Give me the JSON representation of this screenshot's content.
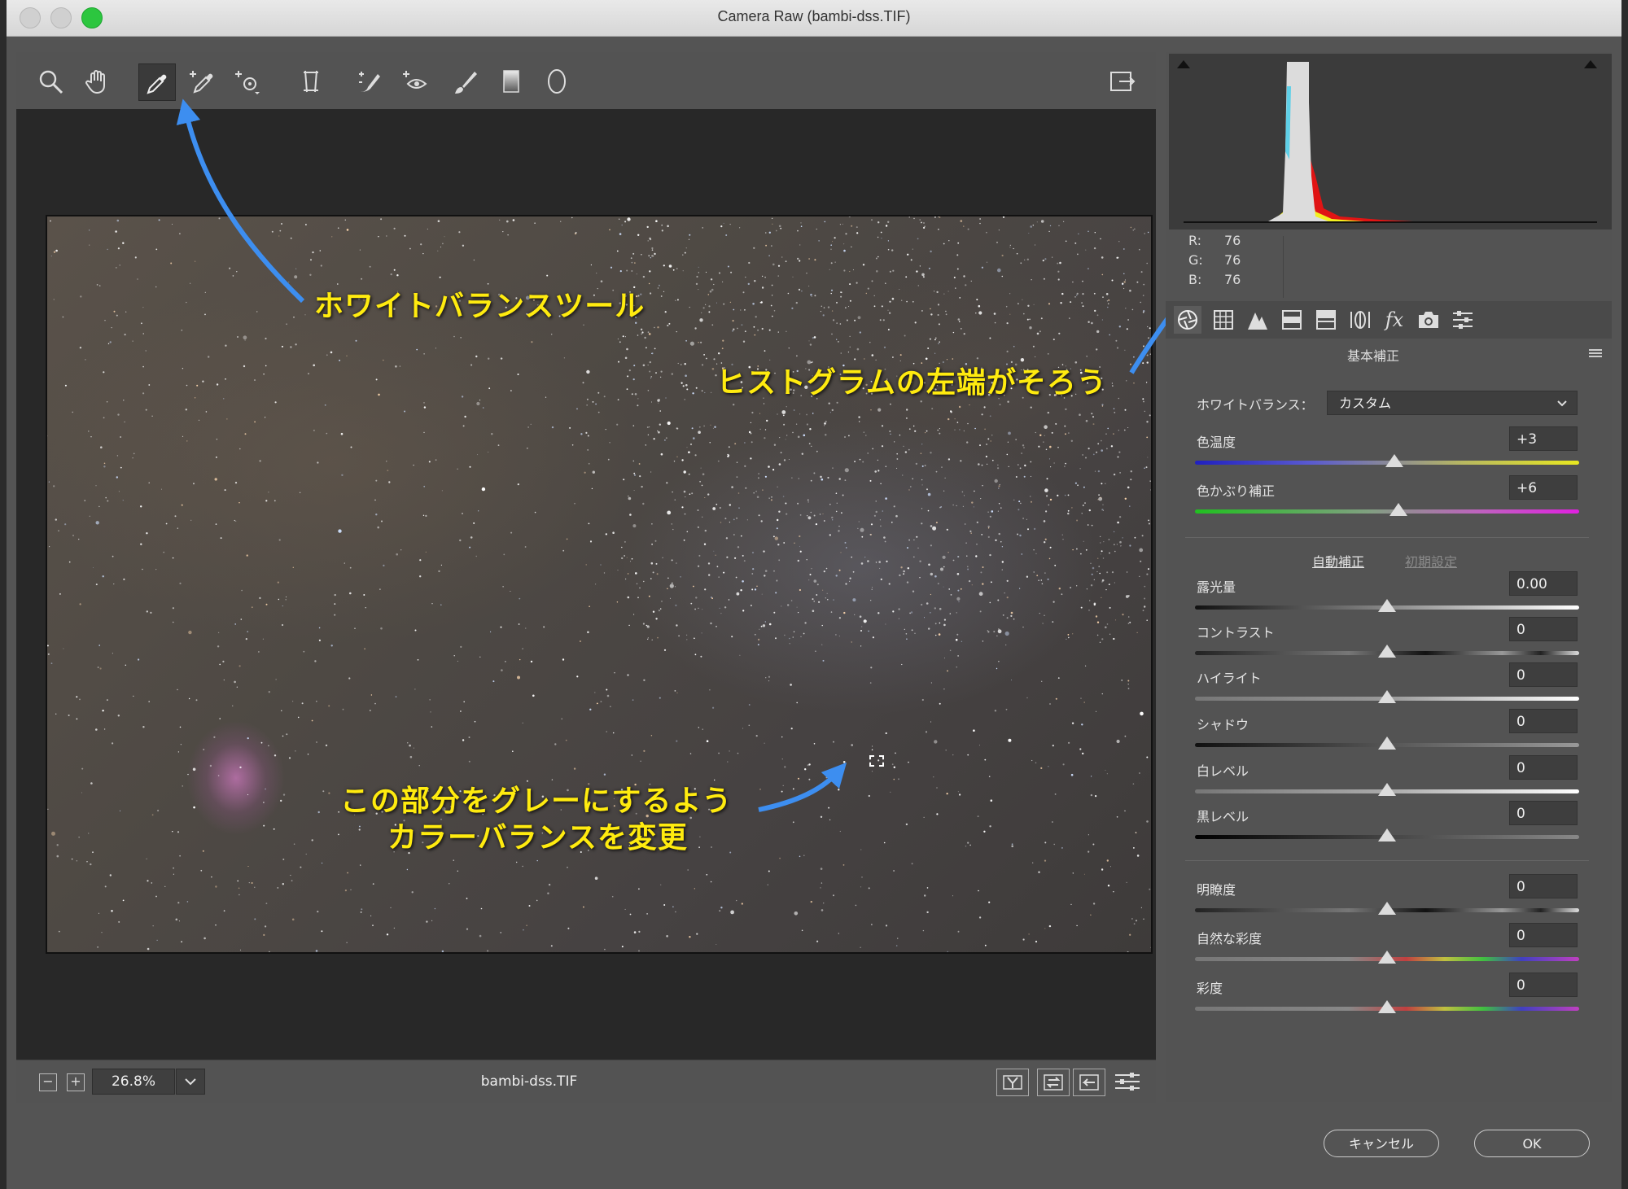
{
  "window": {
    "title": "Camera Raw (bambi-dss.TIF)"
  },
  "annotations": {
    "wb_tool": "ホワイトバランスツール",
    "histogram": "ヒストグラムの左端がそろう",
    "gray_line1": "この部分をグレーにするよう",
    "gray_line2": "カラーバランスを変更"
  },
  "toolbar": {
    "tools": [
      "zoom-tool",
      "hand-tool",
      "white-balance-tool",
      "color-sampler-tool",
      "targeted-adjustment-tool",
      "transform-tool",
      "spot-removal-tool",
      "red-eye-tool",
      "adjustment-brush-tool",
      "graduated-filter-tool",
      "radial-filter-tool"
    ],
    "selected": "white-balance-tool"
  },
  "statusbar": {
    "zoom": "26.8%",
    "filename": "bambi-dss.TIF",
    "minus": "−",
    "plus": "+"
  },
  "histogram": {
    "r_label": "R:",
    "g_label": "G:",
    "b_label": "B:",
    "r": "76",
    "g": "76",
    "b": "76"
  },
  "panel": {
    "title": "基本補正",
    "white_balance": {
      "label": "ホワイトバランス：",
      "value": "カスタム"
    },
    "auto_label": "自動補正",
    "default_label": "初期設定",
    "colors": {
      "accent_yellow": "#ffeb0f",
      "arrow_blue": "#3d8ef0"
    },
    "sliders": [
      {
        "label": "色温度",
        "value": "+3",
        "level": 0.52
      },
      {
        "label": "色かぶり補正",
        "value": "+6",
        "level": 0.53
      },
      {
        "label": "露光量",
        "value": "0.00",
        "level": 0.5
      },
      {
        "label": "コントラスト",
        "value": "0",
        "level": 0.5
      },
      {
        "label": "ハイライト",
        "value": "0",
        "level": 0.5
      },
      {
        "label": "シャドウ",
        "value": "0",
        "level": 0.5
      },
      {
        "label": "白レベル",
        "value": "0",
        "level": 0.5
      },
      {
        "label": "黒レベル",
        "value": "0",
        "level": 0.5
      },
      {
        "label": "明瞭度",
        "value": "0",
        "level": 0.5
      },
      {
        "label": "自然な彩度",
        "value": "0",
        "level": 0.5
      },
      {
        "label": "彩度",
        "value": "0",
        "level": 0.5
      }
    ]
  },
  "buttons": {
    "cancel": "キャンセル",
    "ok": "OK"
  }
}
